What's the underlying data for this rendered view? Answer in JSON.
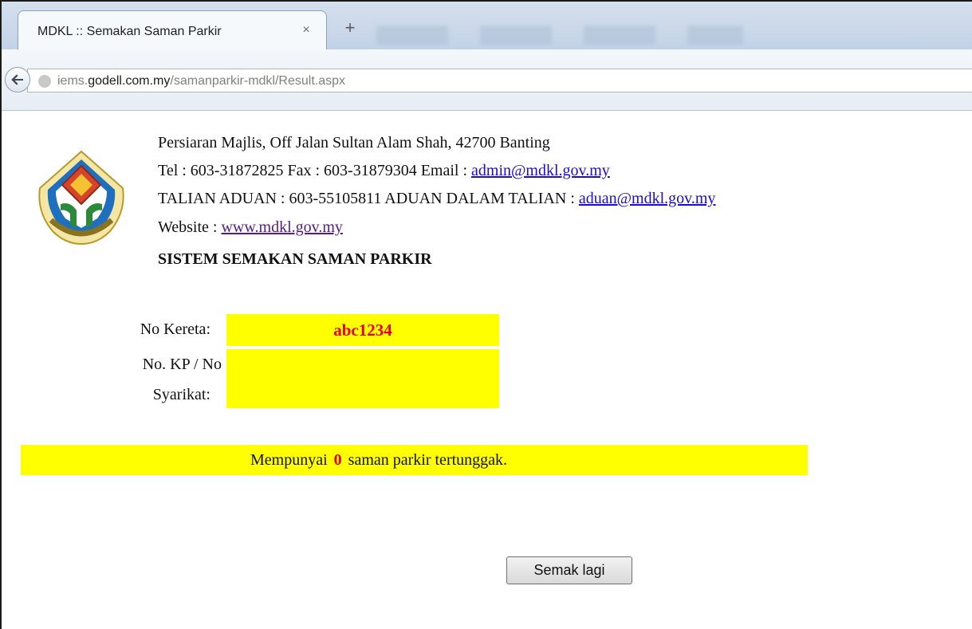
{
  "browser": {
    "tab_title": "MDKL :: Semakan Saman Parkir",
    "tab_close": "×",
    "new_tab": "+",
    "url_prefix": "iems.",
    "url_domain": "godell.com.my",
    "url_path": "/samanparkir-mdkl/Result.aspx"
  },
  "header": {
    "address": "Persiaran Majlis, Off Jalan Sultan Alam Shah, 42700 Banting",
    "contact_prefix": "Tel : 603-31872825 Fax : 603-31879304 Email : ",
    "email": "admin@mdkl.gov.my",
    "complaint_prefix": "TALIAN ADUAN : 603-55105811 ADUAN DALAM TALIAN : ",
    "complaint_email": "aduan@mdkl.gov.my",
    "website_prefix": "Website : ",
    "website": "www.mdkl.gov.my",
    "system_title": "SISTEM SEMAKAN SAMAN PARKIR"
  },
  "form": {
    "car_label": "No Kereta:",
    "car_value": "abc1234",
    "ic_label_line1": "No. KP / No",
    "ic_label_line2": "Syarikat:",
    "ic_value": ""
  },
  "result": {
    "prefix": "Mempunyai",
    "count": "0",
    "suffix": "saman parkir tertunggak."
  },
  "actions": {
    "check_again_label": "Semak lagi"
  },
  "colors": {
    "highlight": "#ffff00",
    "emphasis": "#e60000",
    "link": "#1a0dcc"
  },
  "icons": {
    "back": "back-arrow-icon",
    "globe": "globe-icon",
    "logo": "mdkl-crest-logo"
  }
}
